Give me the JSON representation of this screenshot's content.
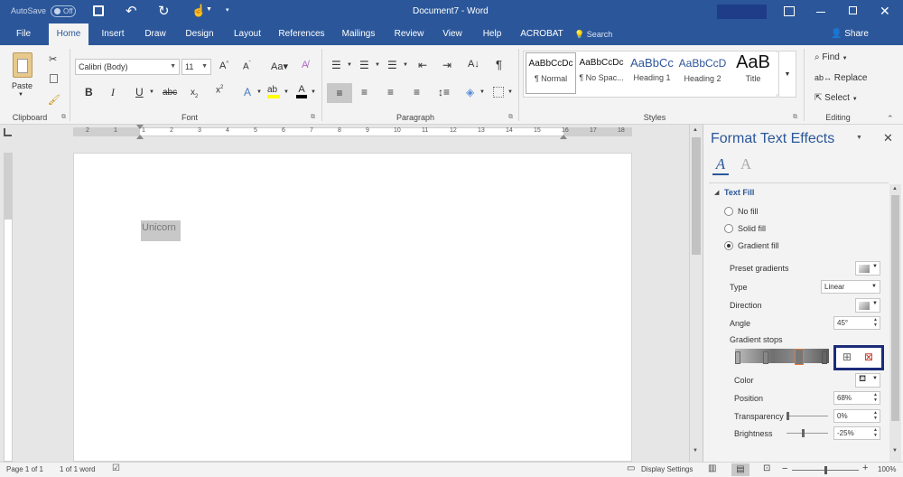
{
  "titlebar": {
    "autosave": "AutoSave",
    "toggle": "Off",
    "doc_title": "Document7  -  Word"
  },
  "tabs": [
    "File",
    "Home",
    "Insert",
    "Draw",
    "Design",
    "Layout",
    "References",
    "Mailings",
    "Review",
    "View",
    "Help",
    "ACROBAT"
  ],
  "search_label": "Search",
  "share_label": "Share",
  "clipboard": {
    "paste": "Paste",
    "group": "Clipboard"
  },
  "font": {
    "name": "Calibri (Body)",
    "size": "11",
    "group": "Font"
  },
  "paragraph": {
    "group": "Paragraph"
  },
  "styles": {
    "group": "Styles",
    "items": [
      {
        "preview": "AaBbCcDc",
        "name": "¶ Normal"
      },
      {
        "preview": "AaBbCcDc",
        "name": "¶ No Spac..."
      },
      {
        "preview": "AaBbCc",
        "name": "Heading 1"
      },
      {
        "preview": "AaBbCcD",
        "name": "Heading 2"
      },
      {
        "preview": "AaB",
        "name": "Title"
      }
    ]
  },
  "editing": {
    "find": "Find",
    "replace": "Replace",
    "select": "Select",
    "group": "Editing"
  },
  "ruler": {
    "labels": [
      "2",
      "1",
      "1",
      "2",
      "3",
      "4",
      "5",
      "6",
      "7",
      "8",
      "9",
      "10",
      "11",
      "12",
      "13",
      "14",
      "15",
      "16",
      "17",
      "18"
    ]
  },
  "document": {
    "text": "Unicorn"
  },
  "pane": {
    "title": "Format Text Effects",
    "section": "Text Fill",
    "fill_options": [
      "No fill",
      "Solid fill",
      "Gradient fill"
    ],
    "selected_fill": "Gradient fill",
    "preset_gradients": "Preset gradients",
    "type_label": "Type",
    "type_value": "Linear",
    "direction_label": "Direction",
    "angle_label": "Angle",
    "angle_value": "45°",
    "stops_label": "Gradient stops",
    "color_label": "Color",
    "position_label": "Position",
    "position_value": "68%",
    "transparency_label": "Transparency",
    "transparency_value": "0%",
    "brightness_label": "Brightness",
    "brightness_value": "-25%"
  },
  "status": {
    "page": "Page 1 of 1",
    "words": "1 of 1 word",
    "display": "Display Settings",
    "zoom": "100%"
  }
}
